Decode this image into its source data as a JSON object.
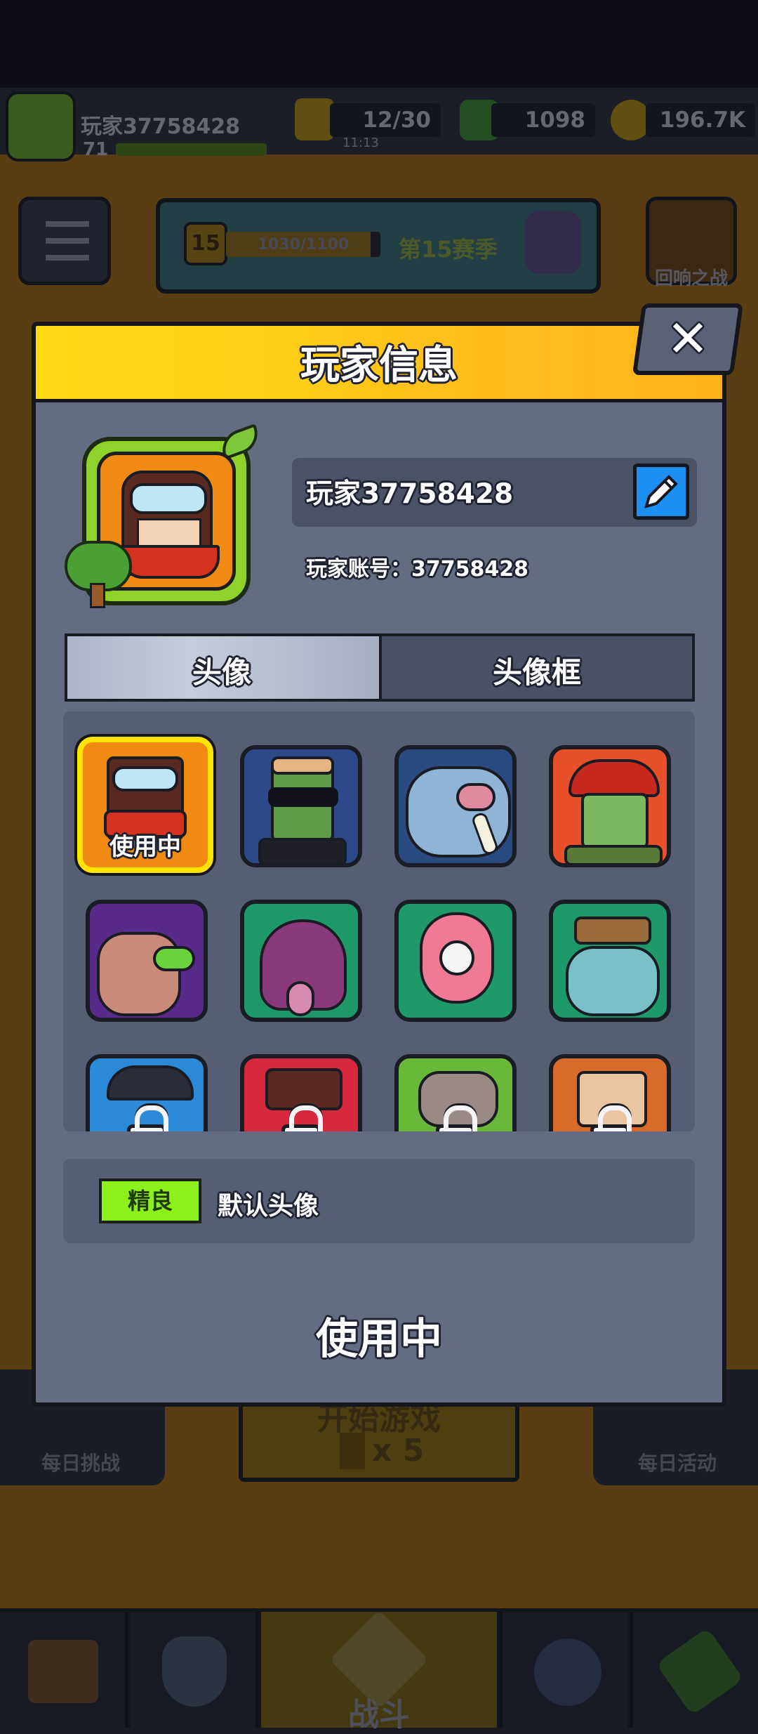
{
  "hud": {
    "player_name": "玩家37758428",
    "player_level": "71",
    "energy": "12/30",
    "energy_timer": "11:13",
    "gems": "1098",
    "coins": "196.7K"
  },
  "season": {
    "level": "15",
    "progress": "1030/1100",
    "progress_fraction": 0.936,
    "name": "第15赛季"
  },
  "side_buttons": {
    "echo_battle": "回响之战",
    "daily_challenge": "每日挑战",
    "daily_event": "每日活动"
  },
  "start_game": {
    "label": "开始游戏",
    "cost": "x 5"
  },
  "bottom_nav": {
    "battle": "战斗"
  },
  "modal": {
    "title": "玩家信息",
    "player_name": "玩家37758428",
    "account_label": "玩家账号：37758428",
    "tabs": [
      "头像",
      "头像框"
    ],
    "in_use_badge": "使用中",
    "rarity": "精良",
    "selected_name": "默认头像",
    "status_button": "使用中"
  },
  "colors": {
    "header_yellow": "#ffd814",
    "panel": "#646c82",
    "edit_blue": "#1d8ef2",
    "rarity_green": "#8cf01a",
    "selected_border": "#ffe400"
  }
}
